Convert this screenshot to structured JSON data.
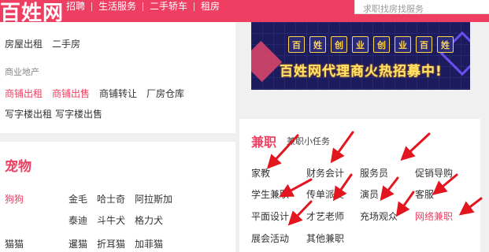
{
  "header": {
    "logo": "百姓网",
    "nav": [
      "招聘",
      "生活服务",
      "二手轿车",
      "租房"
    ],
    "search_placeholder": "求职找房找服务"
  },
  "left_top": {
    "row1": [
      "房屋出租",
      "二手房"
    ],
    "commercial_label": "商业地产",
    "row2": [
      "商铺出租",
      "商铺出售",
      "商铺转让",
      "厂房仓库"
    ],
    "row3": [
      "写字楼出租",
      "写字楼出售"
    ]
  },
  "pets": {
    "title": "宠物",
    "dog_label": "狗狗",
    "dog_row1": [
      "金毛",
      "哈士奇",
      "阿拉斯加"
    ],
    "dog_row2": [
      "泰迪",
      "斗牛犬",
      "格力犬"
    ],
    "cat_label": "猫猫",
    "cat_row": [
      "暹猫",
      "折耳猫",
      "加菲猫"
    ]
  },
  "banner": {
    "tiles": [
      "百",
      "姓",
      "创",
      "业",
      "创",
      "业",
      "百",
      "姓"
    ],
    "headline": "百姓网代理商火热招募中!"
  },
  "parttime": {
    "title": "兼职",
    "subtitle": "兼职小任务",
    "items": [
      {
        "label": "家教",
        "highlight": false
      },
      {
        "label": "财务会计",
        "highlight": false
      },
      {
        "label": "服务员",
        "highlight": false
      },
      {
        "label": "促销导购",
        "highlight": false
      },
      {
        "label": "学生兼职",
        "highlight": false
      },
      {
        "label": "传单派发",
        "highlight": false
      },
      {
        "label": "演员",
        "highlight": false
      },
      {
        "label": "客服",
        "highlight": false
      },
      {
        "label": "平面设计",
        "highlight": false
      },
      {
        "label": "才艺老师",
        "highlight": false
      },
      {
        "label": "充场观众",
        "highlight": false
      },
      {
        "label": "网络兼职",
        "highlight": true
      },
      {
        "label": "展会活动",
        "highlight": false
      },
      {
        "label": "其他兼职",
        "highlight": false
      }
    ]
  },
  "colors": {
    "brand": "#ee3f63",
    "arrow": "#e3161f",
    "banner_bg": "#1c1b5e",
    "banner_text": "#ffe36a"
  }
}
